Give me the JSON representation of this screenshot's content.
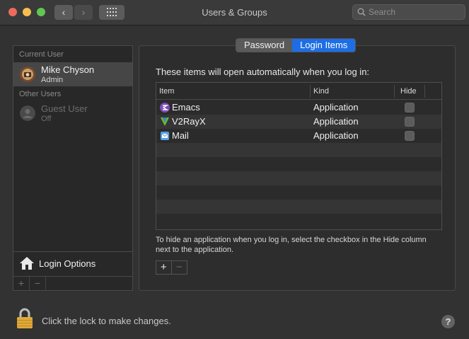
{
  "window": {
    "title": "Users & Groups"
  },
  "toolbar": {
    "back_glyph": "‹",
    "forward_glyph": "›",
    "search_placeholder": "Search"
  },
  "sidebar": {
    "current_user_label": "Current User",
    "current_user": {
      "name": "Mike Chyson",
      "role": "Admin"
    },
    "other_users_label": "Other Users",
    "other_users": [
      {
        "name": "Guest User",
        "role": "Off"
      }
    ],
    "login_options_label": "Login Options",
    "add_glyph": "+",
    "remove_glyph": "−"
  },
  "tabs": [
    {
      "label": "Password",
      "active": false
    },
    {
      "label": "Login Items",
      "active": true
    }
  ],
  "login_items": {
    "heading": "These items will open automatically when you log in:",
    "columns": {
      "item": "Item",
      "kind": "Kind",
      "hide": "Hide"
    },
    "rows": [
      {
        "item": "Emacs",
        "kind": "Application",
        "hide": false,
        "icon": "emacs-icon"
      },
      {
        "item": "V2RayX",
        "kind": "Application",
        "hide": false,
        "icon": "v2rayx-icon"
      },
      {
        "item": "Mail",
        "kind": "Application",
        "hide": false,
        "icon": "mail-icon"
      }
    ],
    "hint": "To hide an application when you log in, select the checkbox in the Hide column next to the application.",
    "add_glyph": "+",
    "remove_glyph": "−"
  },
  "footer": {
    "lock_text": "Click the lock to make changes.",
    "help_glyph": "?"
  },
  "colors": {
    "accent": "#1d6ee6",
    "window_bg": "#323232",
    "lock_gold": "#e0a93a"
  }
}
